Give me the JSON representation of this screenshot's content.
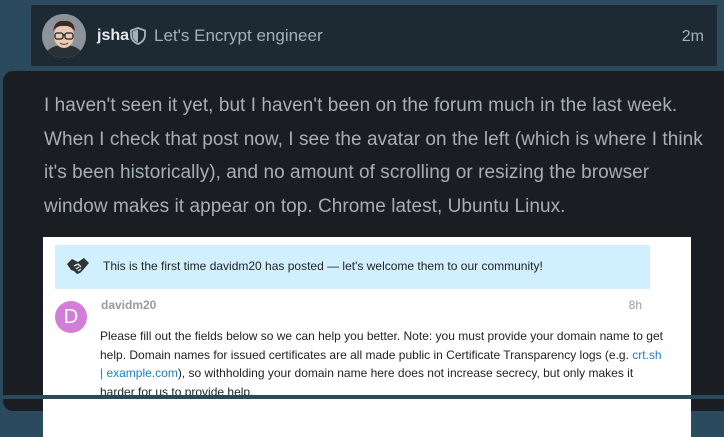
{
  "post": {
    "username": "jsha",
    "user_title": "Let's Encrypt engineer",
    "time": "2m",
    "paragraph_lines": [
      "I haven't seen it yet, but I haven't been on the forum much in the last week.",
      "When I check that post now, I see the avatar on the left (which is where I think",
      "it's been historically), and no amount of scrolling or resizing the browser",
      "window makes it appear on top. Chrome latest, Ubuntu Linux."
    ]
  },
  "embed": {
    "welcome_text": "This is the first time davidm20 has posted — let's welcome them to our community!",
    "avatar_letter": "D",
    "username": "davidm20",
    "time": "8h",
    "text_part1": "Please fill out the fields below so we can help you better. Note: you must provide your domain name to get help. Domain names for issued certificates are all made public in Certificate Transparency logs (e.g. ",
    "link_text": "crt.sh | example.com",
    "text_part2": "), so withholding your domain name here does not increase secrecy, but only makes it harder for us to provide help."
  },
  "icons": {
    "user_badge": "shield-icon",
    "welcome": "handshake-icon"
  },
  "colors": {
    "background": "#2c4a5e",
    "card": "#1a1e23",
    "banner": "#d1f0ff",
    "avatar_d": "#d27ed8",
    "link": "#1a7fc1"
  }
}
